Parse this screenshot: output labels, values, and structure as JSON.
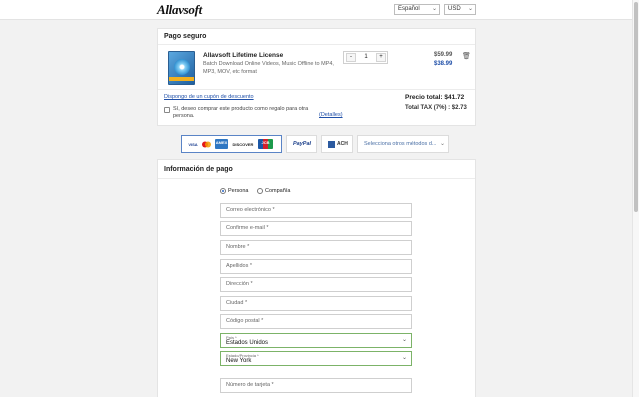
{
  "header": {
    "logo": "Allavsoft",
    "language": "Español",
    "currency": "USD"
  },
  "order": {
    "title": "Pago seguro",
    "product_name": "Allavsoft Lifetime License",
    "product_desc_line1": "Batch Download Online Videos, Music Offline to MP4,",
    "product_desc_line2": "MP3, MOV, etc format",
    "quantity": "1",
    "qty_minus": "-",
    "qty_plus": "+",
    "old_price": "$59.99",
    "price": "$38.99",
    "coupon_link": "Dispongo de un cupón de descuento",
    "gift_line1": "Sí, deseo comprar este producto como regalo para otra",
    "gift_line2": "persona.",
    "details_link": "(Detalles)",
    "total_label": "Precio total: $41.72",
    "tax_label": "Total TAX (7%) : $2.73"
  },
  "payment_methods": {
    "card_logos": [
      "VISA",
      "MC",
      "AMEX",
      "DISCOVER",
      "JCB"
    ],
    "paypal": "PayPal",
    "ach": "ACH",
    "other": "Selecciona otros métodos d..."
  },
  "payment_info": {
    "title": "Información de pago",
    "type_person": "Persona",
    "type_company": "Compañía",
    "fields": {
      "email": "Correo electrónico *",
      "confirm_email": "Confirme e-mail *",
      "first_name": "Nombre *",
      "last_name": "Apellidos *",
      "address": "Dirección *",
      "city": "Ciudad *",
      "postal": "Código postal *",
      "country_label": "País *",
      "country_value": "Estados Unidos",
      "state_label": "Estado/Provincia *",
      "state_value": "New York",
      "card_number": "Número de tarjeta *"
    }
  },
  "colors": {
    "accent": "#2a68c8",
    "valid_border": "#7cb368",
    "price_blue": "#1f4fa8"
  }
}
